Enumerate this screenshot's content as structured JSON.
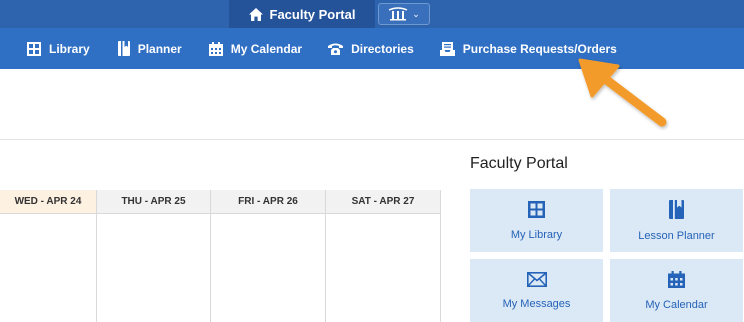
{
  "topbar": {
    "portal_tab_label": "Faculty Portal",
    "portal_tab_icon": "home-icon",
    "switcher_icon": "columns-logo-icon",
    "switcher_caret": "chevron-down-icon"
  },
  "nav": {
    "items": [
      {
        "label": "Library",
        "icon": "grid-icon"
      },
      {
        "label": "Planner",
        "icon": "book-icon"
      },
      {
        "label": "My Calendar",
        "icon": "calendar-icon"
      },
      {
        "label": "Directories",
        "icon": "phone-icon"
      },
      {
        "label": "Purchase Requests/Orders",
        "icon": "inbox-icon"
      }
    ]
  },
  "calendar": {
    "columns": [
      {
        "label": "WED - APR 24",
        "highlight": true
      },
      {
        "label": "THU - APR 25",
        "highlight": false
      },
      {
        "label": "FRI - APR 26",
        "highlight": false
      },
      {
        "label": "SAT - APR 27",
        "highlight": false
      }
    ]
  },
  "faculty_portal": {
    "title": "Faculty Portal",
    "tiles": [
      {
        "label": "My Library",
        "icon": "grid-icon"
      },
      {
        "label": "Lesson Planner",
        "icon": "book-icon"
      },
      {
        "label": "My Messages",
        "icon": "envelope-icon"
      },
      {
        "label": "My Calendar",
        "icon": "calendar-icon"
      }
    ]
  },
  "colors": {
    "topbar": "#2e63ad",
    "navbar": "#2f6fc4",
    "tile_bg": "#dbe8f5",
    "tile_text": "#2563b8",
    "highlight_col": "#fdf1e2",
    "arrow": "#f39b2b"
  },
  "annotation": {
    "type": "arrow",
    "color": "#f39b2b"
  }
}
